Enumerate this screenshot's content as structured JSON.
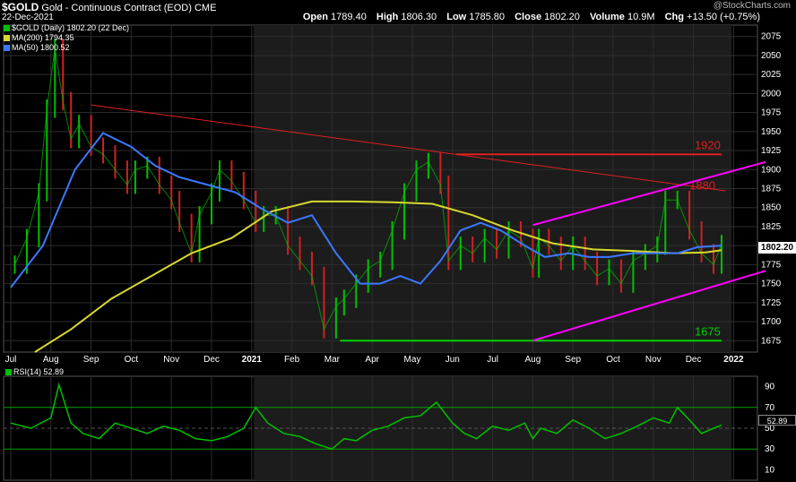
{
  "header": {
    "symbol": "$GOLD",
    "description": "Gold - Continuous Contract (EOD)",
    "exchange": "CME",
    "date": "22-Dec-2021",
    "brand": "@StockCharts.com",
    "open_label": "Open",
    "open": "1789.40",
    "high_label": "High",
    "high": "1806.30",
    "low_label": "Low",
    "low": "1785.80",
    "close_label": "Close",
    "close": "1802.20",
    "volume_label": "Volume",
    "volume": "10.9M",
    "chg_label": "Chg",
    "chg": "+13.50 (+0.75%)"
  },
  "legend": {
    "price": "$GOLD (Daily) 1802.20 (22 Dec)",
    "ma200": "MA(200) 1794.35",
    "ma50": "MA(50) 1800.52",
    "rsi": "RSI(14) 52.89"
  },
  "colors": {
    "background": "#000000",
    "shaded": "#1c1c1c",
    "grid": "#2e2e2e",
    "up_bar": "#00c000",
    "down_bar": "#d02020",
    "ma200": "#d8d830",
    "ma50": "#3c78ff",
    "trendline_red": "#e02020",
    "channel_magenta": "#ff00ff",
    "support_green": "#00d000",
    "rsi_line": "#00c000",
    "rsi_band": "#00a000"
  },
  "chart_data": {
    "type": "line",
    "price_axis": {
      "ylim": [
        1660,
        2090
      ],
      "ticks": [
        "2075",
        "2050",
        "2025",
        "2000",
        "1975",
        "1950",
        "1925",
        "1900",
        "1875",
        "1850",
        "1825",
        "1800",
        "1775",
        "1750",
        "1725",
        "1700",
        "1675"
      ]
    },
    "x_ticks": [
      "Jul",
      "Aug",
      "Sep",
      "Oct",
      "Nov",
      "Dec",
      "2021",
      "Feb",
      "Mar",
      "Apr",
      "May",
      "Jun",
      "Jul",
      "Aug",
      "Sep",
      "Oct",
      "Nov",
      "Dec",
      "2022"
    ],
    "x_tick_pos": [
      0,
      1,
      2,
      3,
      4,
      5,
      6,
      7,
      8,
      9,
      10,
      11,
      12,
      13,
      14,
      15,
      16,
      17,
      18
    ],
    "price_series": {
      "name": "$GOLD",
      "x": [
        0.1,
        0.4,
        0.7,
        0.9,
        1.1,
        1.3,
        1.5,
        1.7,
        2.0,
        2.3,
        2.6,
        2.9,
        3.1,
        3.4,
        3.7,
        4.0,
        4.2,
        4.5,
        4.7,
        5.0,
        5.2,
        5.5,
        5.8,
        6.1,
        6.3,
        6.6,
        6.9,
        7.2,
        7.5,
        7.8,
        8.1,
        8.3,
        8.6,
        8.9,
        9.2,
        9.5,
        9.8,
        10.1,
        10.4,
        10.7,
        10.9,
        11.2,
        11.5,
        11.8,
        12.1,
        12.4,
        12.7,
        13.0,
        13.15,
        13.4,
        13.7,
        14.0,
        14.3,
        14.6,
        14.9,
        15.2,
        15.5,
        15.8,
        16.1,
        16.3,
        16.6,
        16.9,
        17.2,
        17.5,
        17.7
      ],
      "values": [
        1775,
        1810,
        1870,
        1980,
        2060,
        1990,
        1940,
        1960,
        1930,
        1920,
        1900,
        1880,
        1900,
        1905,
        1880,
        1860,
        1830,
        1790,
        1840,
        1870,
        1900,
        1885,
        1860,
        1830,
        1840,
        1840,
        1800,
        1780,
        1760,
        1690,
        1720,
        1730,
        1750,
        1770,
        1780,
        1820,
        1870,
        1900,
        1910,
        1880,
        1780,
        1800,
        1790,
        1810,
        1795,
        1820,
        1810,
        1770,
        1810,
        1800,
        1780,
        1800,
        1780,
        1760,
        1770,
        1750,
        1780,
        1790,
        1800,
        1860,
        1860,
        1820,
        1790,
        1775,
        1802
      ]
    },
    "ma200": {
      "name": "MA(200)",
      "x": [
        0.6,
        1.5,
        2.5,
        3.5,
        4.5,
        5.5,
        6.5,
        7.5,
        8.5,
        9.5,
        10.5,
        11.5,
        12.5,
        13.5,
        14.5,
        15.5,
        16.5,
        17.3,
        17.7
      ],
      "values": [
        1660,
        1690,
        1730,
        1760,
        1790,
        1810,
        1845,
        1858,
        1858,
        1857,
        1855,
        1840,
        1820,
        1803,
        1795,
        1793,
        1790,
        1791,
        1794
      ]
    },
    "ma50": {
      "name": "MA(50)",
      "x": [
        0,
        0.8,
        1.6,
        2.3,
        3.0,
        3.6,
        4.2,
        4.9,
        5.6,
        6.2,
        6.9,
        7.5,
        8.1,
        8.7,
        9.2,
        9.7,
        10.2,
        10.7,
        11.2,
        11.7,
        12.2,
        12.8,
        13.3,
        13.9,
        14.4,
        14.9,
        15.5,
        16.1,
        16.6,
        17.1,
        17.7
      ],
      "values": [
        1745,
        1800,
        1900,
        1948,
        1930,
        1905,
        1890,
        1880,
        1870,
        1850,
        1830,
        1840,
        1790,
        1750,
        1750,
        1760,
        1750,
        1780,
        1820,
        1830,
        1820,
        1800,
        1785,
        1790,
        1785,
        1785,
        1790,
        1790,
        1790,
        1798,
        1800
      ]
    },
    "annotations": [
      {
        "type": "hline",
        "value": 1920,
        "label": "1920",
        "x0": 11.1,
        "x1": 17.7
      },
      {
        "type": "hline",
        "value": 1675,
        "label": "1675",
        "x0": 8.2,
        "x1": 17.7
      },
      {
        "type": "label",
        "value": 1880,
        "label": "1880",
        "x": 16.9
      },
      {
        "type": "trend",
        "x0": 2.0,
        "y0": 1985,
        "x1": 17.8,
        "y1": 1872
      },
      {
        "type": "trend",
        "x0": 13.0,
        "y0": 1827,
        "x1": 18.8,
        "y1": 1910
      },
      {
        "type": "trend",
        "x0": 13.0,
        "y0": 1675,
        "x1": 18.8,
        "y1": 1767
      }
    ],
    "rsi": {
      "name": "RSI(14)",
      "ylim": [
        0,
        100
      ],
      "ticks": [
        "90",
        "70",
        "50",
        "30",
        "10"
      ],
      "bands": [
        70,
        30
      ],
      "current": "52.89",
      "x": [
        0,
        0.5,
        1.0,
        1.2,
        1.5,
        1.8,
        2.2,
        2.6,
        3.0,
        3.4,
        3.8,
        4.2,
        4.6,
        5.0,
        5.4,
        5.8,
        6.1,
        6.4,
        6.8,
        7.2,
        7.6,
        8.0,
        8.3,
        8.6,
        9.0,
        9.4,
        9.8,
        10.2,
        10.6,
        11.0,
        11.3,
        11.6,
        12.0,
        12.4,
        12.8,
        13.0,
        13.2,
        13.6,
        14.0,
        14.4,
        14.8,
        15.2,
        15.6,
        16.0,
        16.4,
        16.6,
        16.9,
        17.2,
        17.5,
        17.7
      ],
      "values": [
        55,
        50,
        60,
        92,
        55,
        45,
        40,
        55,
        50,
        45,
        52,
        48,
        40,
        38,
        42,
        50,
        70,
        55,
        45,
        42,
        35,
        30,
        40,
        38,
        48,
        52,
        60,
        62,
        75,
        55,
        45,
        40,
        52,
        48,
        55,
        40,
        50,
        45,
        58,
        50,
        40,
        45,
        52,
        60,
        55,
        70,
        58,
        45,
        50,
        53
      ]
    }
  }
}
